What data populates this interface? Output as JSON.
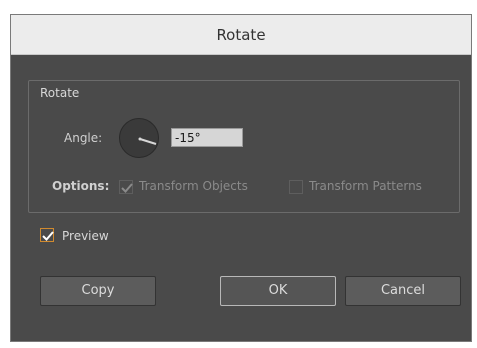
{
  "dialog": {
    "title": "Rotate"
  },
  "rotate_group": {
    "legend": "Rotate",
    "angle_label": "Angle:",
    "angle_value": "-15°",
    "angle_dial_icon": "angle-dial-icon",
    "options_label": "Options:",
    "transform_objects": {
      "label": "Transform Objects",
      "checked": true,
      "enabled": false
    },
    "transform_patterns": {
      "label": "Transform Patterns",
      "checked": false,
      "enabled": false
    }
  },
  "preview": {
    "label": "Preview",
    "checked": true
  },
  "buttons": {
    "copy": "Copy",
    "ok": "OK",
    "cancel": "Cancel"
  },
  "colors": {
    "panel_bg": "#4a4a4a",
    "titlebar_bg": "#ececec",
    "accent_check": "#d08a2f"
  }
}
